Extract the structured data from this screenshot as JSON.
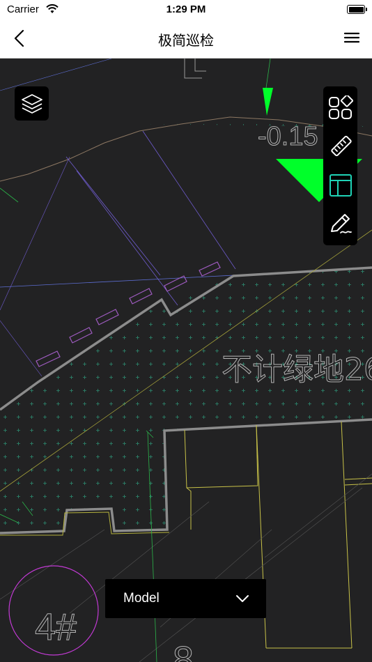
{
  "status_bar": {
    "carrier": "Carrier",
    "time": "1:29 PM"
  },
  "nav": {
    "title": "极简巡检",
    "back_icon": "chevron-left-icon",
    "menu_icon": "hamburger-menu-icon"
  },
  "drawing": {
    "elevation_label": "-0.15",
    "area_label": "不计绿地26",
    "building_label": "4#",
    "bottom_label": "8"
  },
  "toolbar": {
    "layers_icon": "layers-icon",
    "tools": [
      {
        "name": "shapes-tool",
        "icon": "shapes-icon"
      },
      {
        "name": "measure-tool",
        "icon": "ruler-icon"
      },
      {
        "name": "layout-tool",
        "icon": "layout-icon",
        "active_color": "#1fd3b6"
      },
      {
        "name": "markup-tool",
        "icon": "pen-icon"
      }
    ]
  },
  "model_select": {
    "selected": "Model"
  },
  "colors": {
    "background": "#222223",
    "accent": "#1fd3b6",
    "marker": "#00ff2a"
  }
}
